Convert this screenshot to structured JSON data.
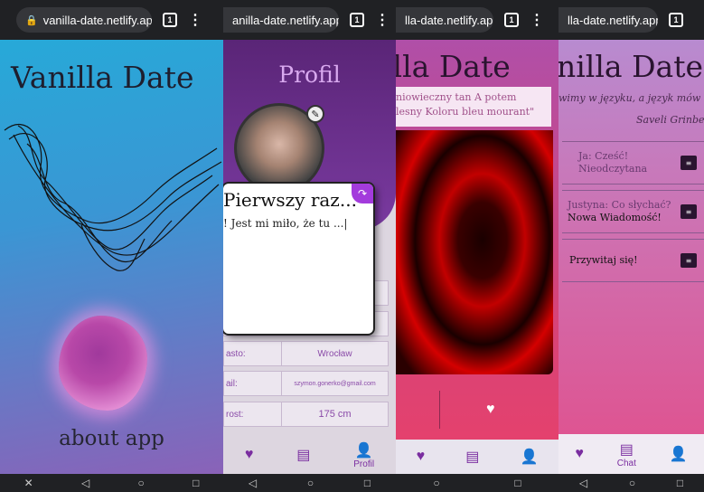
{
  "browser": {
    "p1_url": "vanilla-date.netlify.app",
    "p2_url": "anilla-date.netlify.app/",
    "p3_url": "lla-date.netlify.app/",
    "p4_url": "lla-date.netlify.app/",
    "tab_count": "1"
  },
  "screen1": {
    "title": "Vanilla Date",
    "about": "about app"
  },
  "screen2": {
    "title": "Profil",
    "modal": {
      "title": "Pierwszy raz...",
      "body": "! Jest mi miło, że tu ...|"
    },
    "fields": [
      {
        "key": "asto:",
        "value": "Wrocław"
      },
      {
        "key": "ail:",
        "value": "szymon.gonerko@gmail.com"
      },
      {
        "key": "rost:",
        "value": "175 cm"
      }
    ],
    "tabs": {
      "profil_label": "Profil"
    }
  },
  "screen3": {
    "title": "illa Date",
    "quote_line1": "niowieczny tan A potem",
    "quote_line2": "lesny Koloru bleu mourant\""
  },
  "screen4": {
    "title": "nilla Date",
    "quote": "wimy w języku, a język mów",
    "author": "Saveli Grinbe",
    "messages": [
      {
        "line1": "Ja: Cześć!",
        "line2": "Nieodczytana"
      },
      {
        "line1": "Justyna: Co słychać?",
        "line2": "Nowa Wiadomość!"
      },
      {
        "line1": "Przywitaj się!",
        "line2": ""
      }
    ],
    "tabs": {
      "chat_label": "Chat"
    }
  },
  "colors": {
    "accent": "#7a2da0",
    "close": "#a33bdc"
  }
}
